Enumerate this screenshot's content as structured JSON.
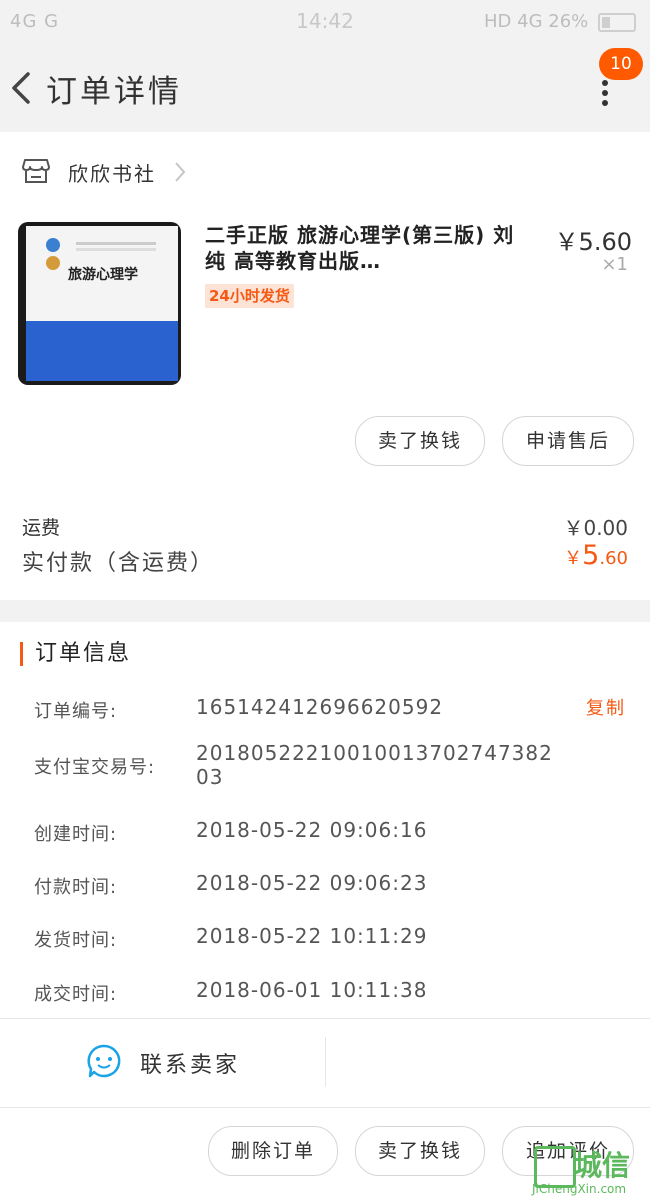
{
  "status_bar": {
    "left": "4G  G  ",
    "time": "14:42",
    "right": "HD 4G 26%"
  },
  "header": {
    "title": "订单详情",
    "badge": "10"
  },
  "shop": {
    "name": "欣欣书社"
  },
  "product": {
    "cover_title": "旅游心理学",
    "title": "二手正版 旅游心理学(第三版) 刘纯 高等教育出版…",
    "tag": "24小时发货",
    "price": "￥5.60",
    "qty": "×1"
  },
  "actions": {
    "sell_label": "卖了换钱",
    "after_sale_label": "申请售后"
  },
  "fees": {
    "shipping_label": "运费",
    "shipping_value": "￥0.00",
    "paid_label": "实付款（含运费）",
    "paid_currency": "￥",
    "paid_int": "5",
    "paid_dec": ".60"
  },
  "order_info": {
    "title": "订单信息",
    "copy_label": "复制",
    "rows": [
      {
        "label": "订单编号:",
        "value": "165142412696620592"
      },
      {
        "label": "支付宝交易号:",
        "value": "2018052221001001370274738203"
      },
      {
        "label": "创建时间:",
        "value": "2018-05-22 09:06:16"
      },
      {
        "label": "付款时间:",
        "value": "2018-05-22 09:06:23"
      },
      {
        "label": "发货时间:",
        "value": "2018-05-22 10:11:29"
      },
      {
        "label": "成交时间:",
        "value": "2018-06-01 10:11:38"
      }
    ]
  },
  "contact": {
    "label": "联系卖家"
  },
  "bottom": {
    "delete_label": "删除订单",
    "sell_label": "卖了换钱",
    "review_label": "追加评价"
  },
  "watermark": {
    "text": "城信",
    "url": "JiChengXin.com"
  },
  "colors": {
    "accent": "#f55a14",
    "badge": "#ff5a00",
    "background_gray": "#f2f2f2"
  }
}
